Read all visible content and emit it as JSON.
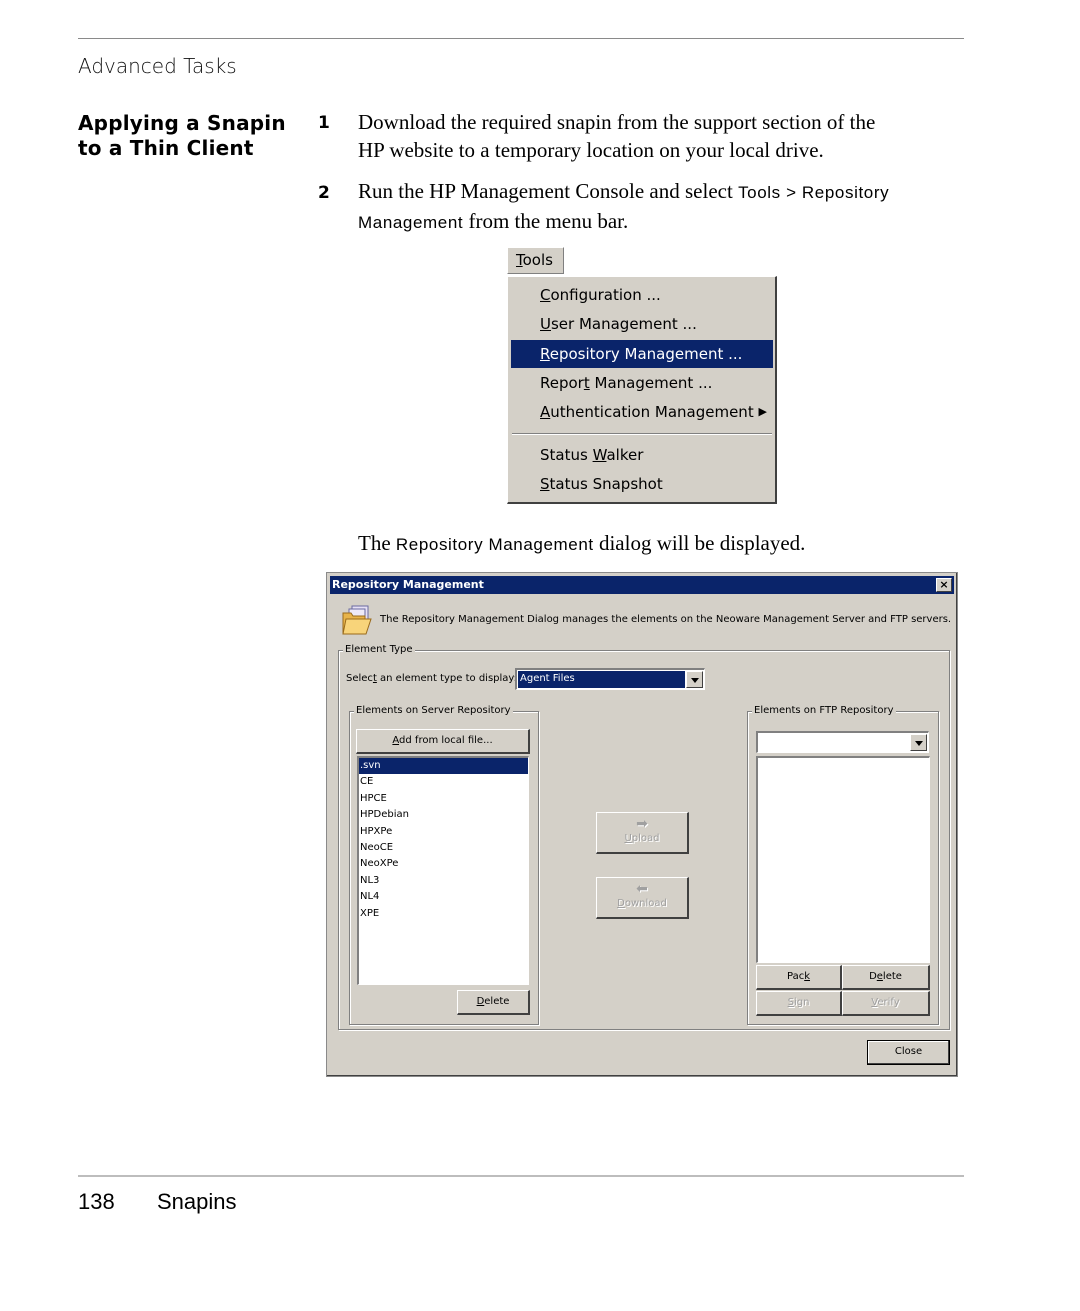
{
  "page": {
    "running_header": "Advanced Tasks",
    "section_heading_line1": "Applying a Snapin",
    "section_heading_line2": "to a Thin Client",
    "steps": [
      {
        "number": "1",
        "line1": "Download the required snapin from the support section of the",
        "line2": "HP website to a temporary location on your local drive."
      },
      {
        "number": "2",
        "line1_pre": "Run the HP Management Console and select ",
        "line1_code": "Tools > Repository",
        "line2_code": "Management",
        "line2_post": " from the menu bar."
      }
    ],
    "caption_pre": "The ",
    "caption_code": "Repository Management",
    "caption_post": " dialog will be displayed.",
    "footer_page_number": "138",
    "footer_title": "Snapins"
  },
  "tools_menu": {
    "title": "Tools",
    "title_accel": "T",
    "items": [
      {
        "accel": "C",
        "rest": "onfiguration ...",
        "pre": "",
        "selected": false
      },
      {
        "accel": "U",
        "rest": "ser Management ...",
        "pre": "",
        "selected": false
      },
      {
        "accel": "R",
        "rest": "epository Management ...",
        "pre": "",
        "selected": true
      },
      {
        "pre": "Repor",
        "accel": "t",
        "rest": " Management ...",
        "selected": false
      },
      {
        "accel": "A",
        "rest": "uthentication Management",
        "pre": "",
        "selected": false,
        "submenu": true
      }
    ],
    "items_after_separator": [
      {
        "pre": "Status ",
        "accel": "W",
        "rest": "alker"
      },
      {
        "pre": "",
        "accel": "S",
        "rest": "tatus Snapshot"
      }
    ],
    "submenu_arrow": "▶"
  },
  "dialog": {
    "title": "Repository Management",
    "close_glyph": "×",
    "description": "The Repository Management Dialog manages the elements on the Neoware Management Server and FTP servers.",
    "folder_icon": "folder-open-icon",
    "element_type_group": "Element Type",
    "select_label_pre": "Selec",
    "select_label_accel": "t",
    "select_label_post": " an element type to display:",
    "element_type_value": "Agent Files",
    "server_group": "Elements on Server Repository",
    "add_button_accel": "A",
    "add_button_rest": "dd from local file...",
    "server_items": [
      ".svn",
      "CE",
      "HPCE",
      "HPDebian",
      "HPXPe",
      "NeoCE",
      "NeoXPe",
      "NL3",
      "NL4",
      "XPE"
    ],
    "server_selected_index": 0,
    "server_delete_accel": "D",
    "server_delete_rest": "elete",
    "upload_arrow": "➡",
    "upload_accel": "U",
    "upload_rest": "pload",
    "download_arrow": "⬅",
    "download_accel": "D",
    "download_rest": "ownload",
    "ftp_group": "Elements on FTP Repository",
    "ftp_combo_value": "",
    "ftp_items": [],
    "pack_pre": "Pac",
    "pack_accel": "k",
    "ftp_delete_pre": "D",
    "ftp_delete_accel": "e",
    "ftp_delete_post": "lete",
    "sign_accel": "S",
    "sign_rest": "ign",
    "verify_accel": "V",
    "verify_rest": "erify",
    "close_button": "Close"
  }
}
